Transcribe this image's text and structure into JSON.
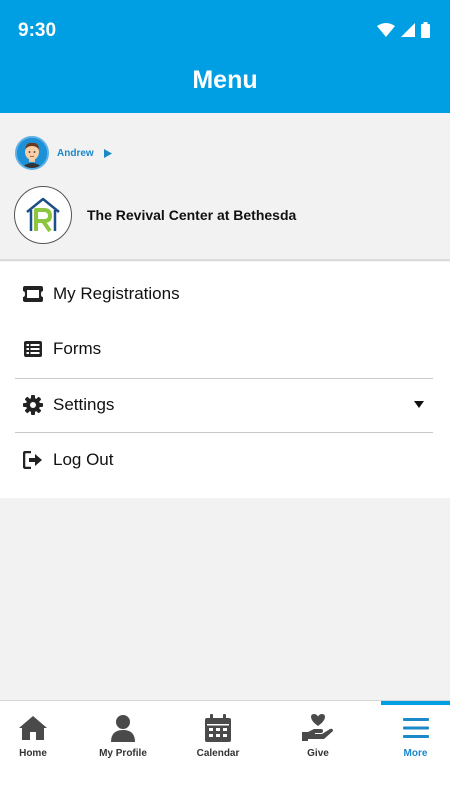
{
  "status_bar": {
    "time": "9:30"
  },
  "header": {
    "title": "Menu"
  },
  "profile": {
    "user_name": "Andrew",
    "church_name": "The Revival Center at Bethesda"
  },
  "menu": {
    "items": [
      {
        "label": "My Registrations",
        "icon": "ticket-icon"
      },
      {
        "label": "Forms",
        "icon": "list-icon"
      },
      {
        "label": "Settings",
        "icon": "gear-icon"
      },
      {
        "label": "Log Out",
        "icon": "logout-icon"
      }
    ]
  },
  "tabs": [
    {
      "label": "Home",
      "icon": "home-icon"
    },
    {
      "label": "My Profile",
      "icon": "person-icon"
    },
    {
      "label": "Calendar",
      "icon": "calendar-icon"
    },
    {
      "label": "Give",
      "icon": "give-icon"
    },
    {
      "label": "More",
      "icon": "hamburger-icon",
      "active": true
    }
  ],
  "colors": {
    "brand": "#009fe3",
    "link": "#1b88c9",
    "active_tab": "#1b88c9"
  }
}
